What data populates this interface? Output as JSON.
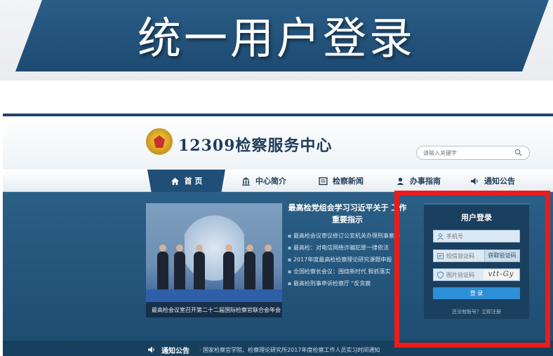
{
  "slide": {
    "title": "统一用户登录"
  },
  "site": {
    "name": "12309检察服务中心",
    "search_placeholder": "请输入关键字"
  },
  "nav": {
    "items": [
      {
        "label": "首 页",
        "icon": "home-icon"
      },
      {
        "label": "中心简介",
        "icon": "building-icon"
      },
      {
        "label": "检察新闻",
        "icon": "news-icon"
      },
      {
        "label": "办事指南",
        "icon": "guide-icon"
      },
      {
        "label": "通知公告",
        "icon": "speaker-icon"
      }
    ]
  },
  "featured": {
    "caption": "最高检会议室召开第二十二届国际检察官联合会年会"
  },
  "news": {
    "headline": "最高检党组会学习习近平关于 工作重要指示",
    "items": [
      "最高检会议审议修订公安机关办理刑事案件",
      "最高检：对电信网络诈骗犯罪一律依法",
      "2017年度最高检检察理论研究课题申报",
      "全国检察长会议：围绕新时代 狠抓落实",
      "最高检刑事申诉检察厅 \"反贪腐"
    ]
  },
  "notice": {
    "label": "通知公告",
    "text": "· 国家检察官学院、检察理论研究所2017年度检察工作人员实习时间通知"
  },
  "login": {
    "title": "用户登录",
    "phone_placeholder": "手机号",
    "sms_placeholder": "短信验证码",
    "sms_button": "获取验证码",
    "captcha_placeholder": "图片验证码",
    "captcha_text": "vtt-Gy",
    "login_button": "登 录",
    "footer": "还没有账号？立即注册"
  },
  "colors": {
    "banner": "#1d4a72",
    "nav_active": "#1f4f76",
    "highlight": "#ec1b1b",
    "login_button": "#2d8fd6"
  }
}
